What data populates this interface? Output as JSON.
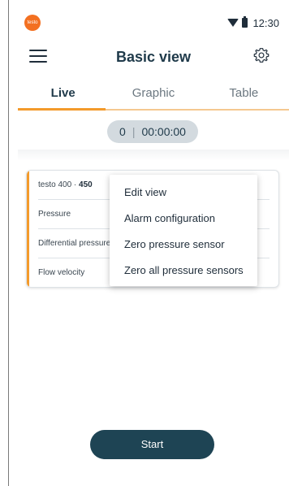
{
  "status_bar": {
    "logo_text": "testo",
    "time": "12:30"
  },
  "header": {
    "title": "Basic view",
    "menu_icon": "hamburger-menu-icon",
    "settings_icon": "gear-icon"
  },
  "tabs": [
    {
      "label": "Live",
      "active": true
    },
    {
      "label": "Graphic",
      "active": false
    },
    {
      "label": "Table",
      "active": false
    }
  ],
  "timer": {
    "count": "0",
    "separator": "|",
    "elapsed": "00:00:00"
  },
  "card": {
    "device_name": "testo 400 · ",
    "device_model": "450",
    "rows": [
      {
        "label": "Pressure"
      },
      {
        "label": "Differential pressure"
      },
      {
        "label": "Flow velocity"
      }
    ]
  },
  "context_menu": {
    "items": [
      {
        "label": "Edit view"
      },
      {
        "label": "Alarm configuration"
      },
      {
        "label": "Zero pressure sensor"
      },
      {
        "label": "Zero all pressure sensors"
      }
    ]
  },
  "actions": {
    "start_label": "Start"
  },
  "colors": {
    "accent": "#f39a2b",
    "primary": "#1e4454",
    "logo": "#f37021"
  }
}
